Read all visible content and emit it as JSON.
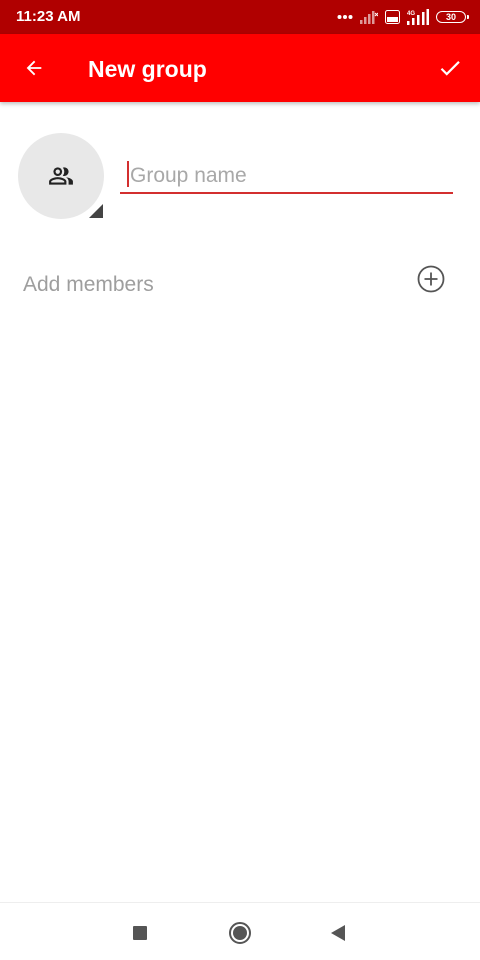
{
  "status_bar": {
    "time": "11:23 AM",
    "battery_level": "30",
    "network_label": "4G",
    "volte_label": "Vo LTE",
    "icons": [
      "dots-icon",
      "signal-weak-icon",
      "volte-icon",
      "signal-4g-icon",
      "battery-icon"
    ]
  },
  "app_bar": {
    "title": "New group",
    "back_icon": "arrow-back-icon",
    "confirm_icon": "check-icon",
    "color": "#ff0000"
  },
  "group": {
    "avatar_icon": "group-icon",
    "name_value": "",
    "name_placeholder": "Group name"
  },
  "members": {
    "add_label": "Add members",
    "add_icon": "add-circle-icon"
  },
  "nav_bar": {
    "icons": [
      "recents-icon",
      "home-icon",
      "back-icon"
    ]
  },
  "colors": {
    "status_bar": "#b00000",
    "accent": "#d32f2f",
    "hint_text": "#9e9e9e"
  }
}
